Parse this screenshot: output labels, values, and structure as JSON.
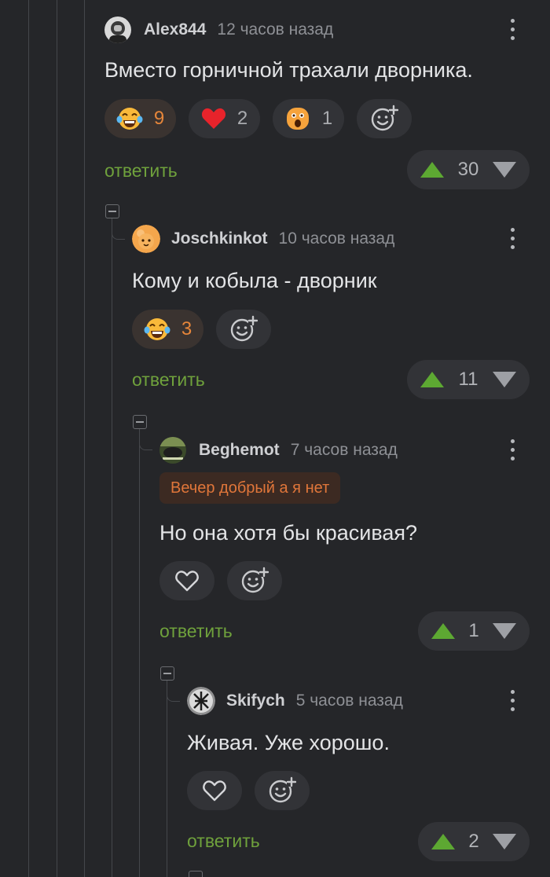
{
  "comments": [
    {
      "username": "Alex844",
      "time": "12 часов назад",
      "text": "Вместо горничной трахали дворника.",
      "reactions": [
        {
          "icon": "laugh-tears-emoji",
          "count": "9",
          "active": true
        },
        {
          "icon": "heart-emoji",
          "count": "2",
          "active": false
        },
        {
          "icon": "shocked-emoji",
          "count": "1",
          "active": false
        }
      ],
      "reply_label": "ответить",
      "score": "30"
    },
    {
      "username": "Joschkinkot",
      "time": "10 часов назад",
      "text": "Кому и кобыла - дворник",
      "reactions": [
        {
          "icon": "laugh-tears-emoji",
          "count": "3",
          "active": true
        }
      ],
      "reply_label": "ответить",
      "score": "11"
    },
    {
      "username": "Beghemot",
      "time": "7 часов назад",
      "tag": "Вечер добрый а я нет",
      "text": "Но она хотя бы красивая?",
      "reply_label": "ответить",
      "score": "1"
    },
    {
      "username": "Skifych",
      "time": "5 часов назад",
      "text": "Живая. Уже хорошо.",
      "reply_label": "ответить",
      "score": "2"
    }
  ],
  "colors": {
    "background": "#252629",
    "reply": "#6fa13c",
    "upvote": "#5da832",
    "reaction_active": "#e6863a"
  }
}
